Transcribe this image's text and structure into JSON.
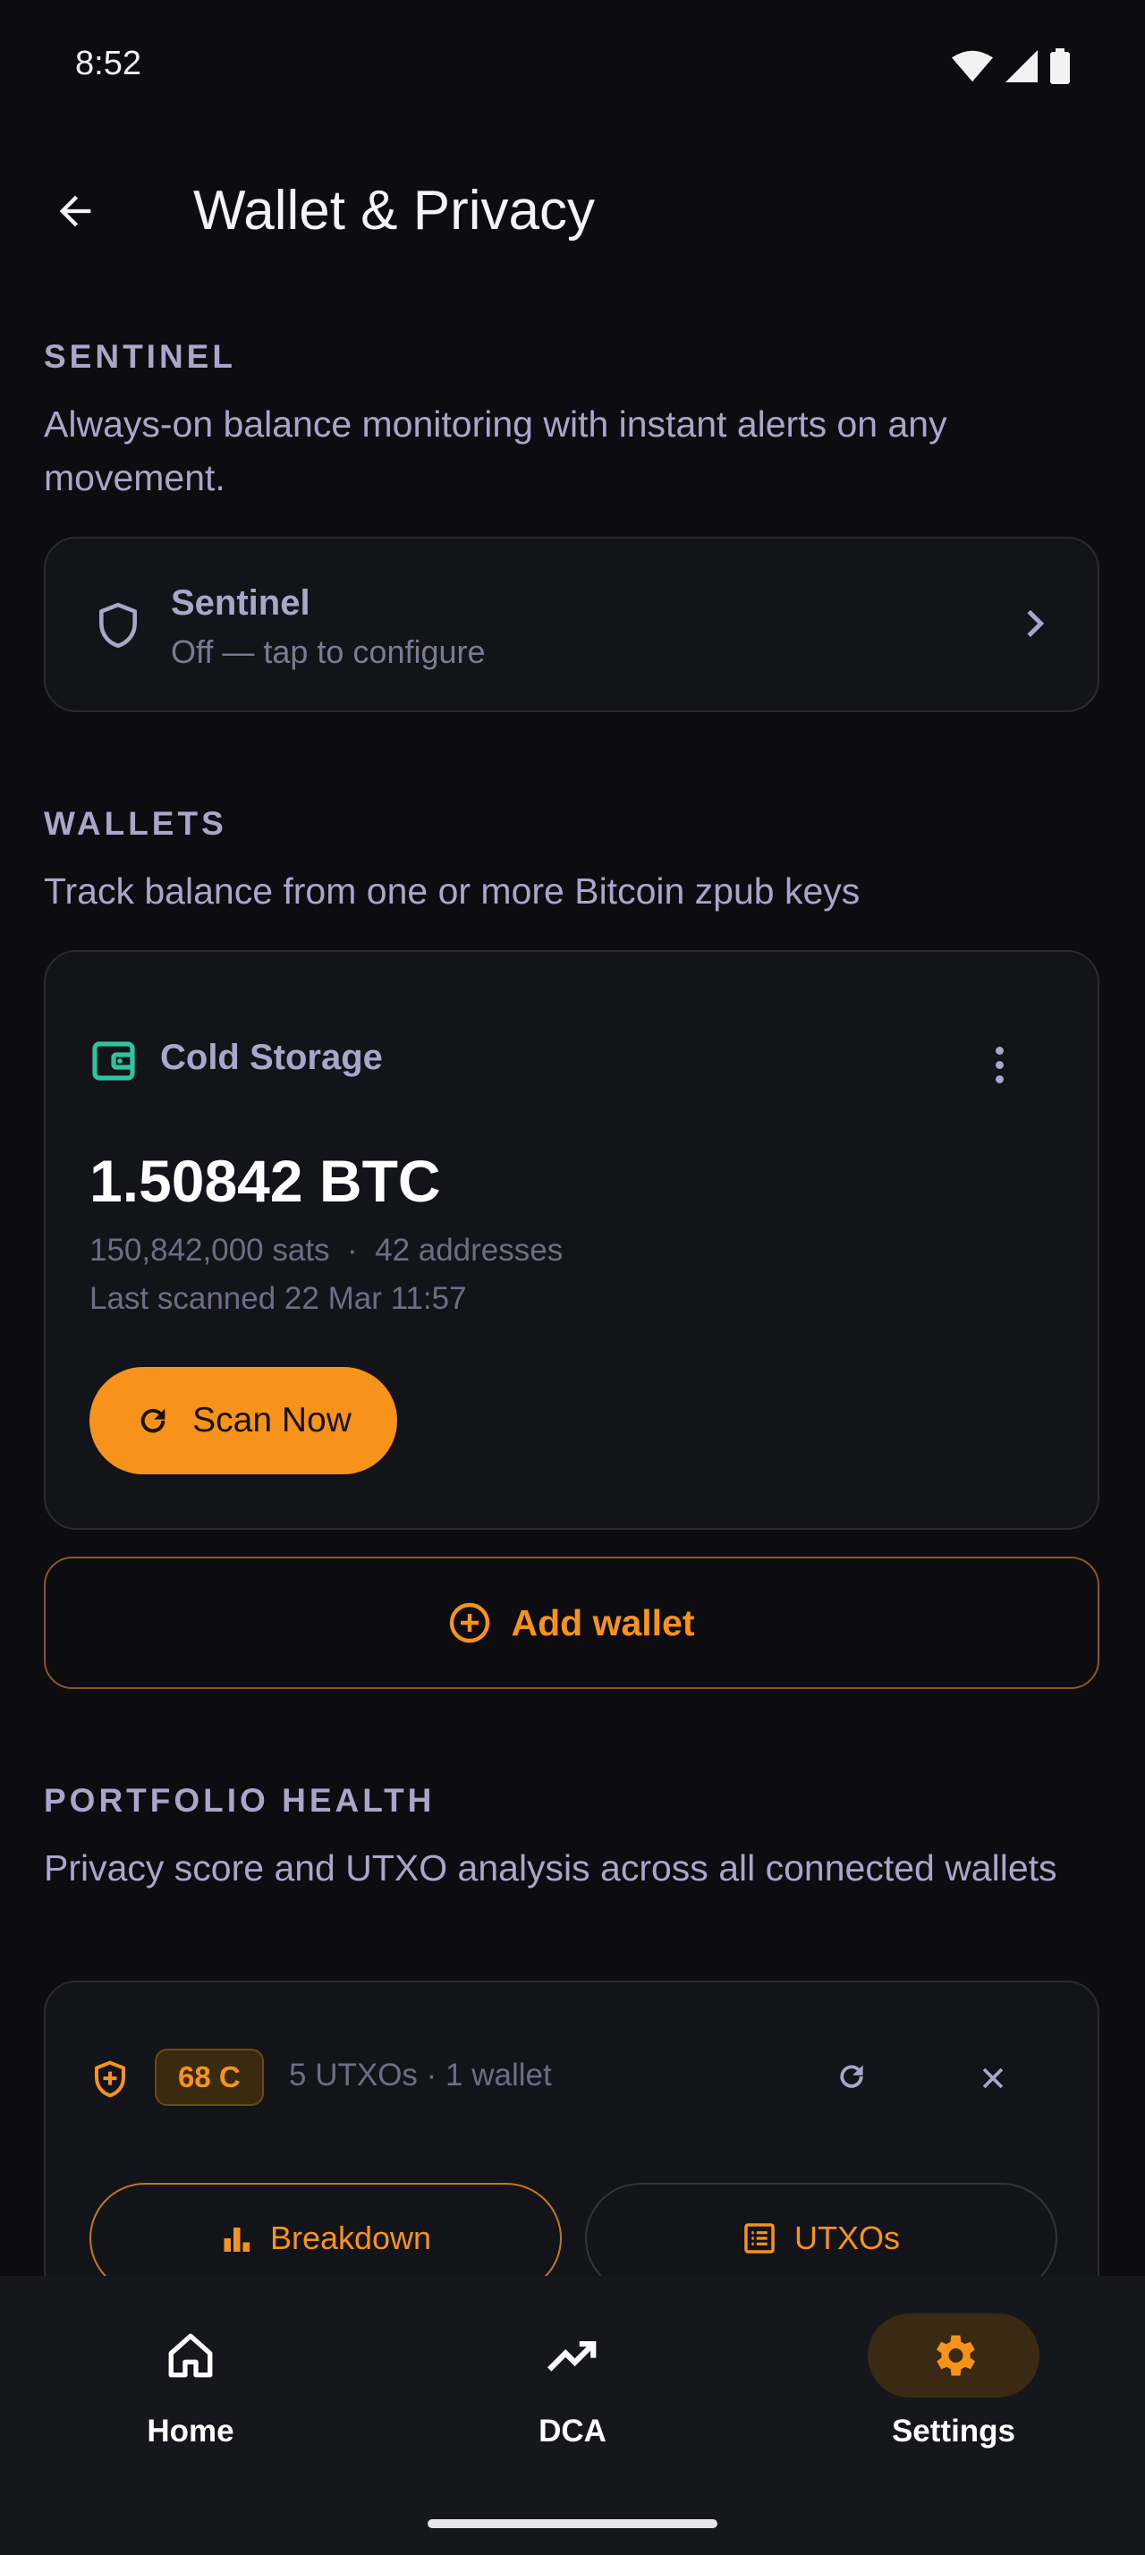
{
  "status_bar": {
    "time": "8:52"
  },
  "app_bar": {
    "title": "Wallet & Privacy"
  },
  "sentinel_section": {
    "label": "SENTINEL",
    "description": "Always-on balance monitoring with instant alerts on any movement.",
    "item_title": "Sentinel",
    "item_subtitle": "Off — tap to configure"
  },
  "wallets_section": {
    "label": "WALLETS",
    "description": "Track balance from one or more Bitcoin zpub keys",
    "wallet": {
      "name": "Cold Storage",
      "balance": "1.50842 BTC",
      "meta": "150,842,000 sats  ·  42 addresses",
      "last_scanned": "Last scanned 22 Mar 11:57",
      "scan_label": "Scan Now"
    },
    "add_label": "Add wallet"
  },
  "health_section": {
    "label": "PORTFOLIO HEALTH",
    "description": "Privacy score and UTXO analysis across all connected wallets",
    "grade": "68 C",
    "summary": "5 UTXOs · 1 wallet",
    "breakdown_label": "Breakdown",
    "utxos_label": "UTXOs"
  },
  "bottom_nav": {
    "items": [
      {
        "label": "Home",
        "icon": "home-icon"
      },
      {
        "label": "DCA",
        "icon": "trending-up-icon"
      },
      {
        "label": "Settings",
        "icon": "gear-icon",
        "active": true
      }
    ]
  },
  "colors": {
    "accent": "#f7931a",
    "wallet_icon": "#2ec4a0",
    "background": "#0c0c11"
  }
}
